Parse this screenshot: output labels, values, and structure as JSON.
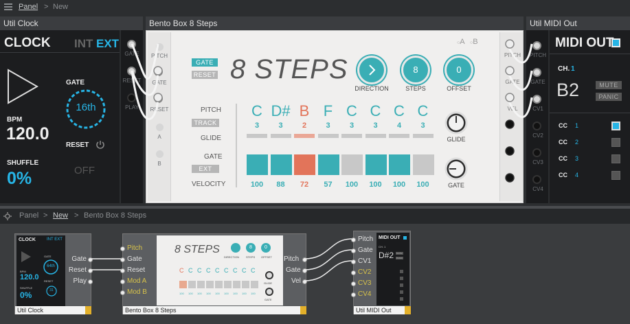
{
  "top_breadcrumb": {
    "panel": "Panel",
    "sep": ">",
    "new": "New"
  },
  "clock": {
    "header": "Util Clock",
    "title": "CLOCK",
    "int": "INT",
    "ext": "EXT",
    "gate_label": "GATE",
    "gate_value": "16th",
    "bpm_label": "BPM",
    "bpm_value": "120.0",
    "reset_label": "RESET",
    "shuffle_label": "SHUFFLE",
    "shuffle_value": "0%",
    "off_label": "OFF",
    "ports": [
      "GATE",
      "RESET",
      "PLAY"
    ]
  },
  "bento": {
    "header": "Bento Box 8 Steps",
    "title": "8 STEPS",
    "gate_tag": "GATE",
    "reset_tag": "RESET",
    "ports": [
      "PITCH",
      "GATE",
      "RESET",
      "A",
      "B"
    ],
    "ab_a": "A",
    "ab_b": "B",
    "knobs": [
      {
        "value": ">",
        "label": "DIRECTION"
      },
      {
        "value": "8",
        "label": "STEPS"
      },
      {
        "value": "0",
        "label": "OFFSET"
      }
    ],
    "pitch_label": "PITCH",
    "track_tag": "TRACK",
    "glide_label": "GLIDE",
    "gate_label": "GATE",
    "ext_tag": "EXT",
    "velocity_label": "VELOCITY",
    "notes": [
      "C",
      "D#",
      "B",
      "F",
      "C",
      "C",
      "C",
      "C"
    ],
    "octaves": [
      "3",
      "3",
      "2",
      "3",
      "3",
      "3",
      "4",
      "3"
    ],
    "velocities": [
      "100",
      "88",
      "72",
      "57",
      "100",
      "100",
      "100",
      "100"
    ],
    "glide_knob": "GLIDE",
    "gate_knob": "GATE"
  },
  "midi": {
    "header": "Util MIDI Out",
    "title": "MIDI OUT",
    "ch_label": "CH.",
    "ch_value": "1",
    "note": "B2",
    "mute": "MUTE",
    "panic": "PANIC",
    "in_ports": [
      "PITCH",
      "GATE",
      "VEL"
    ],
    "cv_ports": [
      "CV1",
      "CV2",
      "CV3",
      "CV4"
    ],
    "cc": [
      {
        "label": "CC",
        "num": "1"
      },
      {
        "label": "CC",
        "num": "2"
      },
      {
        "label": "CC",
        "num": "3"
      },
      {
        "label": "CC",
        "num": "4"
      }
    ]
  },
  "lower_breadcrumb": {
    "panel": "Panel",
    "new": "New",
    "item": "Bento Box 8 Steps"
  },
  "lower": {
    "clock_out": [
      "Gate",
      "Reset",
      "Play"
    ],
    "clock_name": "Util Clock",
    "mini_clock": {
      "title": "CLOCK",
      "mode": "INT EXT",
      "gate": "GATE",
      "gate_val": "64th",
      "bpm": "BPM",
      "bpm_val": "120.0",
      "reset": "RESET",
      "shuffle": "SHUFFLE",
      "shuffle_val": "0%",
      "reset_val": "31"
    },
    "bento_in": [
      "Pitch",
      "Gate",
      "Reset",
      "Mod A",
      "Mod B"
    ],
    "bento_out": [
      "Pitch",
      "Gate",
      "Vel"
    ],
    "bento_name": "Bento Box 8 Steps",
    "mini_bento": {
      "title": "8 STEPS",
      "k1": "DIRECTION",
      "k2": "STEPS",
      "k3": "OFFSET",
      "steps_val": "8",
      "offset_val": "0",
      "glide": "GLIDE",
      "gate": "GATE",
      "vels": [
        "100",
        "100",
        "100",
        "100",
        "100",
        "100",
        "100",
        "100",
        "100"
      ]
    },
    "midi_in": [
      "Pitch",
      "Gate",
      "CV1",
      "CV2",
      "CV3",
      "CV4"
    ],
    "midi_name": "Util MIDI Out",
    "mini_midi": {
      "title": "MIDI OUT",
      "ch": "CH. 1",
      "note": "D#2",
      "mute": "MUTE",
      "panic": "PANIC"
    }
  },
  "colors": {
    "accent": "#3aaeb5",
    "highlight": "#e2745a",
    "cyan": "#27b5e6"
  }
}
